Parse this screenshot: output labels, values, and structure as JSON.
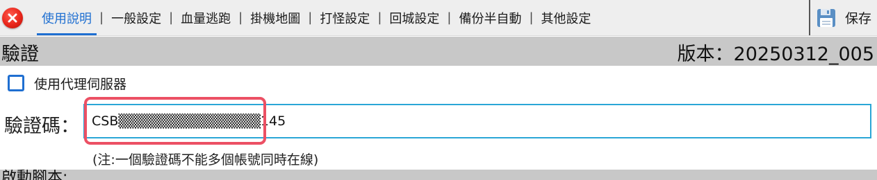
{
  "header": {
    "tabs": [
      {
        "label": "使用說明",
        "active": true
      },
      {
        "label": "一般設定",
        "active": false
      },
      {
        "label": "血量逃跑",
        "active": false
      },
      {
        "label": "掛機地圖",
        "active": false
      },
      {
        "label": "打怪設定",
        "active": false
      },
      {
        "label": "回城設定",
        "active": false
      },
      {
        "label": "備份半自動",
        "active": false
      },
      {
        "label": "其他設定",
        "active": false
      }
    ],
    "separator": "|",
    "save_label": "保存",
    "save_icon": "floppy-disk-icon",
    "close_icon": "close-icon"
  },
  "verification": {
    "title": "驗證",
    "version": "版本：20250312_005"
  },
  "proxy": {
    "label": "使用代理伺服器",
    "checked": false
  },
  "code": {
    "label": "驗證碼：",
    "value": "CSB▒▒▒▒▒▒▒▒▒▒▒▒▒▒145",
    "note": "(注:一個驗證碼不能多個帳號同時在線)"
  },
  "footer": {
    "section_label": "啟動腳本:"
  },
  "colors": {
    "accent": "#1f6fd1",
    "highlight": "#ec5064",
    "input_border": "#2aa6d6",
    "section_bg": "#c8c8c8"
  }
}
